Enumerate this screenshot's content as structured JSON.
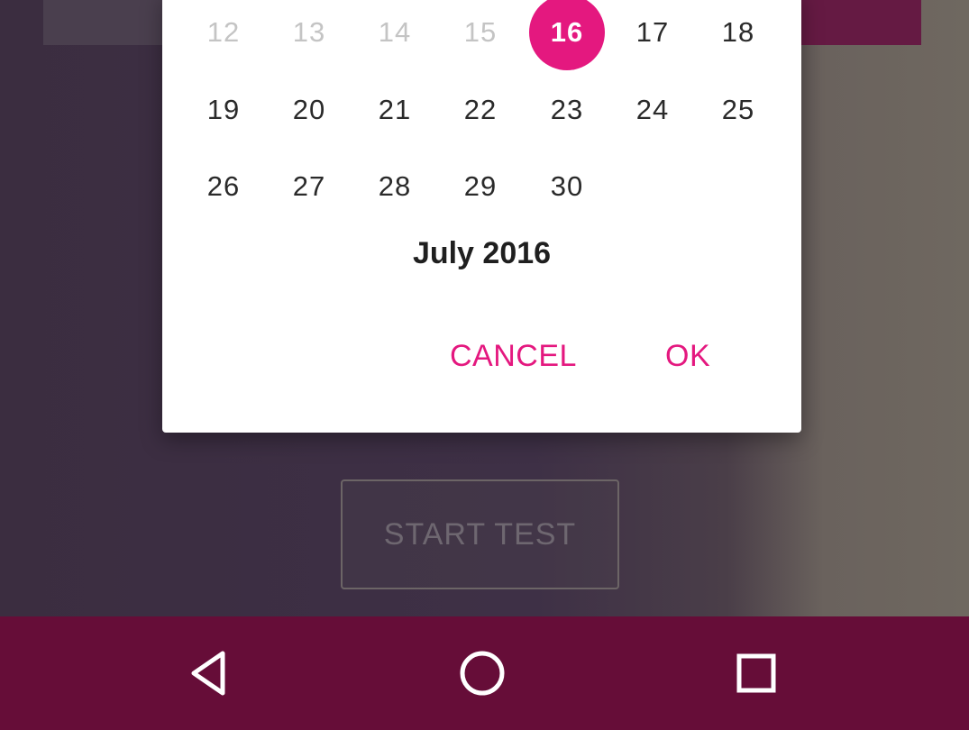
{
  "calendar": {
    "rows": [
      [
        {
          "label": "12",
          "state": "disabled"
        },
        {
          "label": "13",
          "state": "disabled"
        },
        {
          "label": "14",
          "state": "disabled"
        },
        {
          "label": "15",
          "state": "disabled"
        },
        {
          "label": "16",
          "state": "selected"
        },
        {
          "label": "17",
          "state": "normal"
        },
        {
          "label": "18",
          "state": "normal"
        }
      ],
      [
        {
          "label": "19",
          "state": "normal"
        },
        {
          "label": "20",
          "state": "normal"
        },
        {
          "label": "21",
          "state": "normal"
        },
        {
          "label": "22",
          "state": "normal"
        },
        {
          "label": "23",
          "state": "normal"
        },
        {
          "label": "24",
          "state": "normal"
        },
        {
          "label": "25",
          "state": "normal"
        }
      ],
      [
        {
          "label": "26",
          "state": "normal"
        },
        {
          "label": "27",
          "state": "normal"
        },
        {
          "label": "28",
          "state": "normal"
        },
        {
          "label": "29",
          "state": "normal"
        },
        {
          "label": "30",
          "state": "normal"
        }
      ]
    ],
    "month_label": "July 2016"
  },
  "dialog": {
    "cancel_label": "CANCEL",
    "ok_label": "OK"
  },
  "background": {
    "start_button_label": "START TEST"
  },
  "navbar": {
    "back_icon": "back-triangle-icon",
    "home_icon": "home-circle-icon",
    "recent_icon": "recent-apps-square-icon"
  },
  "colors": {
    "accent": "#e4187f",
    "navbar": "#660d38"
  }
}
